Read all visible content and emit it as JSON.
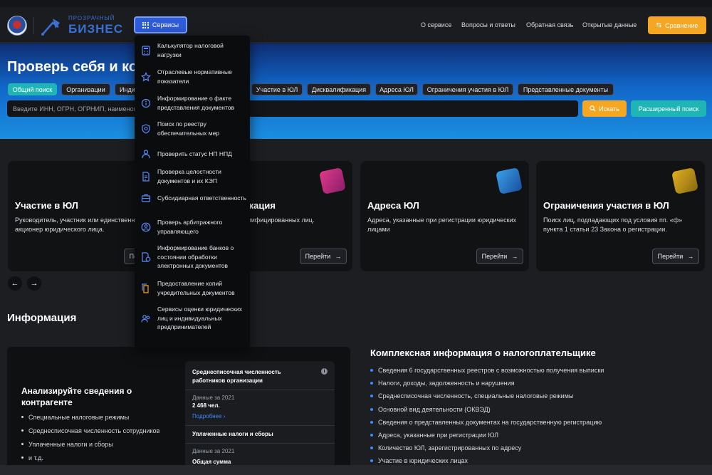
{
  "header": {
    "logo_small": "ПРОЗРАЧНЫЙ",
    "logo_big": "БИЗНЕС",
    "services_label": "Сервисы",
    "nav": [
      "О сервисе",
      "Вопросы и ответы",
      "Обратная связь",
      "Открытые данные"
    ],
    "compare_label": "Сравнение"
  },
  "hero": {
    "title": "Проверь себя и кон",
    "tabs": [
      "Общий поиск",
      "Организации",
      "Инди",
      "Участие в ЮЛ",
      "Дисквалификация",
      "Адреса ЮЛ",
      "Ограничения участия в ЮЛ",
      "Представленные документы"
    ],
    "search_placeholder": "Введите ИНН, ОГРН, ОГРНИП, наименова",
    "search_button": "Искать",
    "advanced_button": "Расширенный поиск"
  },
  "services_menu": [
    {
      "label": "Калькулятор налоговой нагрузки",
      "icon": "calculator-icon"
    },
    {
      "label": "Отраслевые нормативные показатели",
      "icon": "star-icon"
    },
    {
      "label": "Информирование о факте представления документов",
      "icon": "info-icon"
    },
    {
      "label": "Поиск по реестру обеспечительных мер",
      "icon": "search-shield-icon"
    },
    {
      "label": "Проверить статус НП НПД",
      "icon": "person-check-icon"
    },
    {
      "label": "Проверка целостности документов и их КЭП",
      "icon": "document-sign-icon"
    },
    {
      "label": "Субсидиарная ответственность",
      "icon": "briefcase-icon"
    },
    {
      "label": "Проверь арбитражного управляющего",
      "icon": "user-circle-icon"
    },
    {
      "label": "Информирование банков о состоянии обработки электронных документов",
      "icon": "bank-document-icon"
    },
    {
      "label": "Предоставление копий учредительных документов",
      "icon": "copy-documents-icon"
    },
    {
      "label": "Сервисы оценки юридических лиц и индивидуальных предпринимателей",
      "icon": "people-icon"
    }
  ],
  "cards": [
    {
      "title": "Участие в ЮЛ",
      "text": "Руководитель, участник или единственный акционер юридического лица.",
      "button": "Перейти"
    },
    {
      "title": "Дисквалификация",
      "text": "Сведения о дисквалифицированных лиц.",
      "button": "Перейти"
    },
    {
      "title": "Адреса ЮЛ",
      "text": "Адреса, указанные при регистрации юридических лицами",
      "button": "Перейти"
    },
    {
      "title": "Ограничения участия в ЮЛ",
      "text": "Поиск лиц, подпадающих под условия пп. «ф» пункта 1 статьи 23 Закона о регистрации.",
      "button": "Перейти"
    }
  ],
  "info": {
    "title": "Информация",
    "card_title": "Анализируйте сведения о контрагенте",
    "card_list": [
      "Специальные налоговые режимы",
      "Среднесписочная численность сотрудников",
      "Уплаченные налоги и сборы",
      "и т.д."
    ],
    "inner": {
      "headcount_title": "Среднесписочная численность работников организации",
      "headcount_period": "Данные за 2021",
      "headcount_value": "2 468 чел.",
      "more_link": "Подробнее",
      "taxes_title": "Уплаченные налоги и сборы",
      "taxes_period": "Данные за 2021",
      "taxes_total_label": "Общая сумма"
    }
  },
  "complex": {
    "title": "Комплексная информация о налогоплательщике",
    "items": [
      "Сведения 6 государственных реестров с возможностью получения выписки",
      "Налоги, доходы, задолженность и нарушения",
      "Среднесписочная численность, специальные налоговые режимы",
      "Основной вид деятельности (ОКВЭД)",
      "Сведения о представленных документах на государственную регистрацию",
      "Адреса, указанные при регистрации ЮЛ",
      "Количество ЮЛ, зарегистрированных по адресу",
      "Участие в юридических лицах"
    ]
  },
  "colors": {
    "accent": "#2e5bd8",
    "orange": "#f5a623",
    "teal": "#1fb5b5"
  }
}
